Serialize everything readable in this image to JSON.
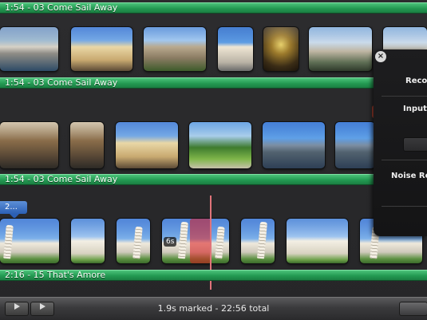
{
  "tracks": [
    {
      "label": "1:54 - 03 Come Sail Away"
    },
    {
      "label": "1:54 - 03 Come Sail Away"
    },
    {
      "label": "1:54 - 03 Come Sail Away"
    },
    {
      "label": "2:16 - 15 That's Amore"
    }
  ],
  "marker": {
    "label": "2..."
  },
  "clip_badge": {
    "label": "6s"
  },
  "panel": {
    "close_symbol": "×",
    "labels": [
      "Recor",
      "Input",
      "Noise Re"
    ]
  },
  "status": {
    "text": "1.9s marked - 22:56 total"
  },
  "controls": {
    "play_icon": "play-icon",
    "play_full_icon": "play-fullscreen-icon"
  },
  "colors": {
    "track_green": "#239a52",
    "scrub_red": "#dc191e",
    "marker_blue": "#2b5fb5"
  }
}
